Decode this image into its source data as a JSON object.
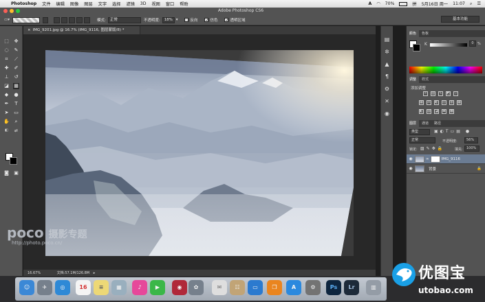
{
  "menubar": {
    "app_name": "Photoshop",
    "items": [
      "文件",
      "编辑",
      "图像",
      "图层",
      "文字",
      "选择",
      "滤镜",
      "3D",
      "视图",
      "窗口",
      "帮助"
    ],
    "battery": "70%",
    "date": "5月16日 周一",
    "time": "11:07"
  },
  "window": {
    "title": "Adobe Photoshop CS6"
  },
  "options_bar": {
    "mode_label": "模式:",
    "mode_value": "正常",
    "opacity_label": "不透明度:",
    "opacity_value": "18%",
    "reverse_label": "反向",
    "dither_label": "仿色",
    "transparency_label": "透明区域",
    "workspace_value": "基本功能"
  },
  "document": {
    "tab_title": "IMG_9201.jpg @ 16.7% (IMG_9116, 图层蒙版/8) *",
    "zoom": "16.67%",
    "doc_size": "文档:57.1M/126.8M"
  },
  "watermark": {
    "brand": "poco",
    "brand_cn": "摄影专题",
    "url": "http://photo.poco.cn/"
  },
  "panels": {
    "color_tabs": [
      "颜色",
      "色板"
    ],
    "color_channel_label": "K",
    "color_channel_value": "0",
    "color_channel_unit": "%",
    "adjust_tabs": [
      "调整",
      "样式"
    ],
    "adjust_title": "添加调整",
    "layer_tabs": [
      "图层",
      "通道",
      "路径"
    ],
    "kind_label": "类型",
    "blend_mode": "正常",
    "opacity_label": "不透明度:",
    "opacity_value": "56%",
    "lock_label": "锁定:",
    "fill_label": "填充:",
    "fill_value": "100%",
    "layers": [
      {
        "name": "IMG_9116"
      },
      {
        "name": "背景"
      }
    ]
  },
  "logo": {
    "name_cn": "优图宝",
    "url": "utobao.com"
  },
  "colors": {
    "panel_bg": "#535353",
    "menubar_bg": "#e8e8e8",
    "logo_blue": "#1aa0e6"
  }
}
